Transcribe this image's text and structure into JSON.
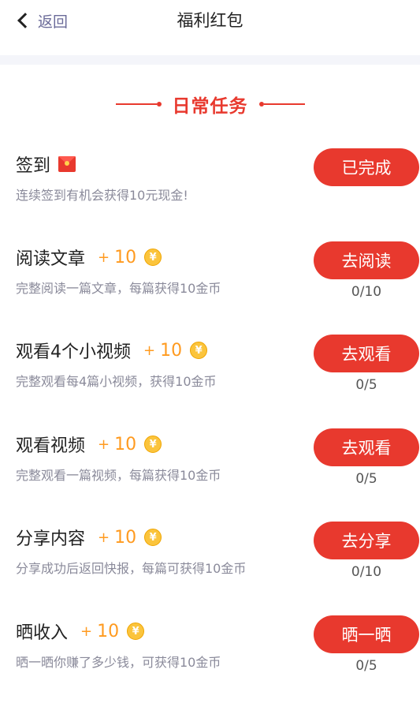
{
  "header": {
    "back_label": "返回",
    "title": "福利红包"
  },
  "section_title": "日常任务",
  "tasks": [
    {
      "name": "签到",
      "icon": "red-envelope-icon",
      "reward": "",
      "desc": "连续签到有机会获得10元现金!",
      "button": "已完成",
      "progress": ""
    },
    {
      "name": "阅读文章",
      "reward": "10",
      "desc": "完整阅读一篇文章，每篇获得10金币",
      "button": "去阅读",
      "progress": "0/10"
    },
    {
      "name": "观看4个小视频",
      "reward": "10",
      "desc": "完整观看每4篇小视频，获得10金币",
      "button": "去观看",
      "progress": "0/5"
    },
    {
      "name": "观看视频",
      "reward": "10",
      "desc": "完整观看一篇视频，每篇获得10金币",
      "button": "去观看",
      "progress": "0/5"
    },
    {
      "name": "分享内容",
      "reward": "10",
      "desc": "分享成功后返回快报，每篇可获得10金币",
      "button": "去分享",
      "progress": "0/10"
    },
    {
      "name": "晒收入",
      "reward": "10",
      "desc": "晒一晒你赚了多少钱，可获得10金币",
      "button": "晒一晒",
      "progress": "0/5"
    }
  ],
  "reward_plus": "+",
  "coin_symbol": "¥",
  "colors": {
    "accent": "#e8392e",
    "reward": "#ff9a1f",
    "coin": "#fbc43c"
  }
}
